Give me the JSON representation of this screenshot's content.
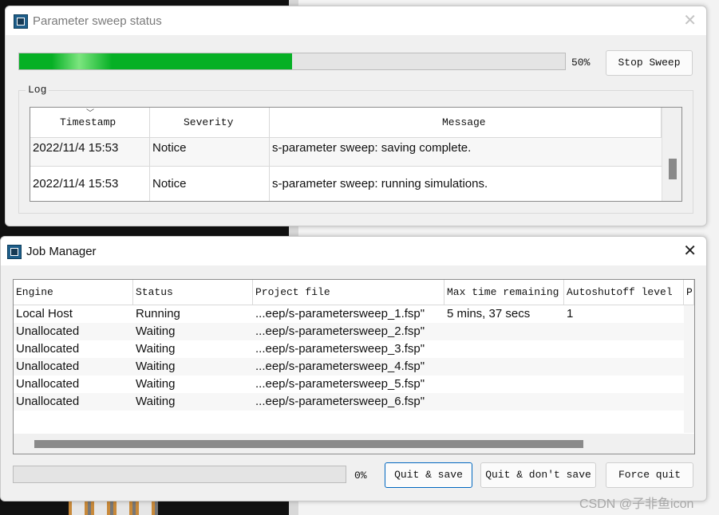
{
  "sweep_window": {
    "title": "Parameter sweep status",
    "progress_fraction": 0.5,
    "progress_label": "50%",
    "stop_button": "Stop Sweep",
    "log_label": "Log",
    "log_columns": [
      "Timestamp",
      "Severity",
      "Message"
    ],
    "log_rows": [
      {
        "timestamp": "2022/11/4 15:53",
        "severity": "Notice",
        "message": "s-parameter sweep: saving complete."
      },
      {
        "timestamp": "2022/11/4 15:53",
        "severity": "Notice",
        "message": "s-parameter sweep: running simulations."
      }
    ]
  },
  "job_window": {
    "title": "Job Manager",
    "columns": [
      "Engine",
      "Status",
      "Project file",
      "Max time remaining",
      "Autoshutoff level",
      "P"
    ],
    "rows": [
      {
        "engine": "Local Host",
        "status": "Running",
        "project": "...eep/s-parametersweep_1.fsp\"",
        "max_time": "5 mins, 37 secs",
        "autoshutoff": "1"
      },
      {
        "engine": "Unallocated",
        "status": "Waiting",
        "project": "...eep/s-parametersweep_2.fsp\"",
        "max_time": "",
        "autoshutoff": ""
      },
      {
        "engine": "Unallocated",
        "status": "Waiting",
        "project": "...eep/s-parametersweep_3.fsp\"",
        "max_time": "",
        "autoshutoff": ""
      },
      {
        "engine": "Unallocated",
        "status": "Waiting",
        "project": "...eep/s-parametersweep_4.fsp\"",
        "max_time": "",
        "autoshutoff": ""
      },
      {
        "engine": "Unallocated",
        "status": "Waiting",
        "project": "...eep/s-parametersweep_5.fsp\"",
        "max_time": "",
        "autoshutoff": ""
      },
      {
        "engine": "Unallocated",
        "status": "Waiting",
        "project": "...eep/s-parametersweep_6.fsp\"",
        "max_time": "",
        "autoshutoff": ""
      }
    ],
    "progress_fraction": 0,
    "progress_label": "0%",
    "buttons": {
      "quit_save": "Quit & save",
      "quit_dont_save": "Quit & don't save",
      "force_quit": "Force quit"
    }
  },
  "watermark": "CSDN @子非鱼icon",
  "colors": {
    "progress_green": "#06b025",
    "icon_blue": "#1e5e8a",
    "focus_blue": "#0067c0"
  }
}
